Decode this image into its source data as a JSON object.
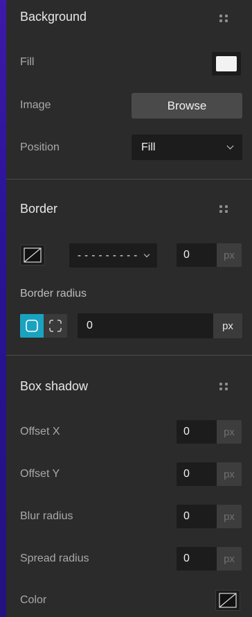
{
  "background": {
    "title": "Background",
    "fill_label": "Fill",
    "image_label": "Image",
    "browse_label": "Browse",
    "position_label": "Position",
    "position_value": "Fill",
    "fill_color": "#f2f2f2"
  },
  "border": {
    "title": "Border",
    "style_value": "- - - - - - - - -",
    "width_value": "0",
    "width_unit": "px",
    "radius_label": "Border radius",
    "radius_value": "0",
    "radius_unit": "px"
  },
  "box_shadow": {
    "title": "Box shadow",
    "rows": [
      {
        "label": "Offset X",
        "value": "0",
        "unit": "px"
      },
      {
        "label": "Offset Y",
        "value": "0",
        "unit": "px"
      },
      {
        "label": "Blur radius",
        "value": "0",
        "unit": "px"
      },
      {
        "label": "Spread radius",
        "value": "0",
        "unit": "px"
      }
    ],
    "color_label": "Color"
  },
  "colors": {
    "accent": "#1aa3c0",
    "panel_bg": "#2b2b2b",
    "field_bg": "#1c1c1c"
  },
  "icons": {
    "drag": "drag-handle-icon",
    "no_color": "no-color-swatch-icon",
    "radius_all": "rounded-square-icon",
    "radius_individual": "corners-icon",
    "dropdown": "chevron-down-icon"
  }
}
